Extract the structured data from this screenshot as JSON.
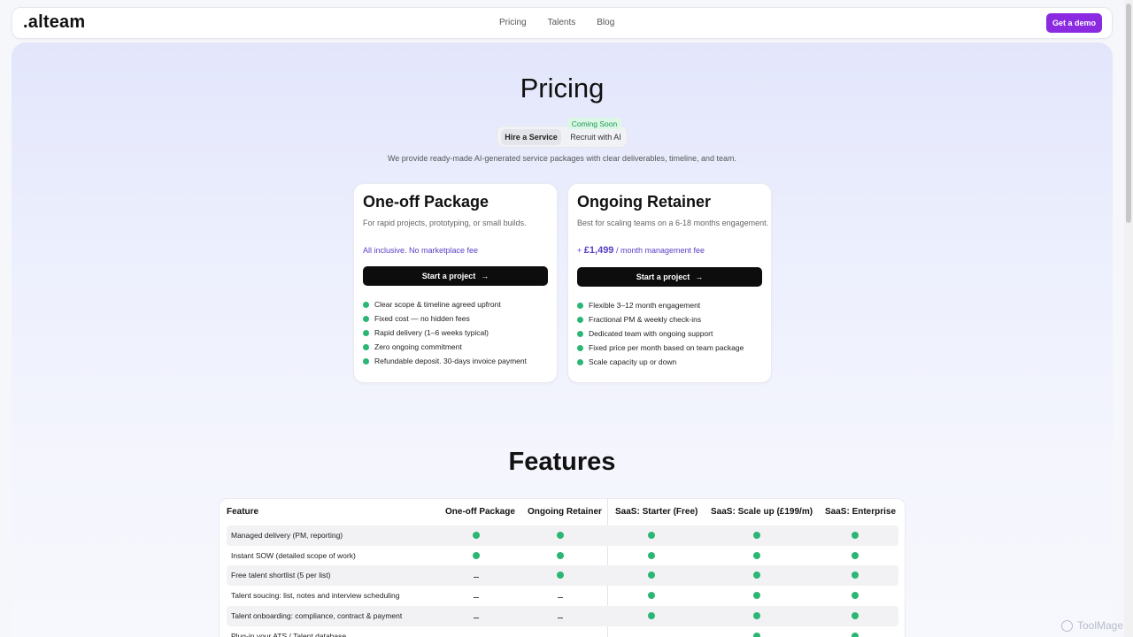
{
  "nav": {
    "logo": ".alteam",
    "links": [
      "Pricing",
      "Talents",
      "Blog"
    ],
    "cta": "Get a demo"
  },
  "hero": {
    "title": "Pricing",
    "toggle_active": "Hire a Service",
    "toggle_other": "Recruit with AI",
    "badge": "Coming Soon",
    "subtitle": "We provide ready-made AI-generated service packages with clear deliverables, timeline, and team."
  },
  "cards": [
    {
      "title": "One-off Package",
      "desc": "For rapid projects, prototyping, or small builds.",
      "note": "All inclusive. No marketplace fee",
      "cta": "Start a project",
      "arrow": "→",
      "features": [
        "Clear scope & timeline agreed upfront",
        "Fixed cost — no hidden fees",
        "Rapid delivery (1–6 weeks typical)",
        "Zero ongoing commitment",
        "Refundable deposit. 30-days invoice payment"
      ]
    },
    {
      "title": "Ongoing Retainer",
      "desc": "Best for scaling teams on a 6-18 months engagement.",
      "price_prefix": "+",
      "price_amount": "£1,499",
      "price_suffix": "/ month management fee",
      "cta": "Start a project",
      "arrow": "→",
      "features": [
        "Flexible 3–12 month engagement",
        "Fractional PM & weekly check-ins",
        "Dedicated team with ongoing support",
        "Fixed price per month based on team package",
        "Scale capacity up or down"
      ]
    }
  ],
  "features_section": {
    "title": "Features",
    "headers": [
      "Feature",
      "One-off Package",
      "Ongoing Retainer",
      "SaaS: Starter (Free)",
      "SaaS: Scale up (£199/m)",
      "SaaS: Enterprise"
    ],
    "rows": [
      {
        "label": "Managed delivery (PM, reporting)",
        "values": [
          "check",
          "check",
          "check",
          "check",
          "check"
        ]
      },
      {
        "label": "Instant SOW (detailed scope of work)",
        "values": [
          "check",
          "check",
          "check",
          "check",
          "check"
        ]
      },
      {
        "label": "Free talent shortlist (5 per list)",
        "values": [
          "dash",
          "check",
          "check",
          "check",
          "check"
        ]
      },
      {
        "label": "Talent soucing: list, notes and interview scheduling",
        "values": [
          "dash",
          "dash",
          "check",
          "check",
          "check"
        ]
      },
      {
        "label": "Talent onboarding: compliance, contract & payment",
        "values": [
          "dash",
          "dash",
          "check",
          "check",
          "check"
        ]
      },
      {
        "label": "Plug-in your ATS / Talent database",
        "values": [
          "dash",
          "dash",
          "dash",
          "check",
          "check"
        ]
      }
    ]
  },
  "watermark": "ToolMage"
}
